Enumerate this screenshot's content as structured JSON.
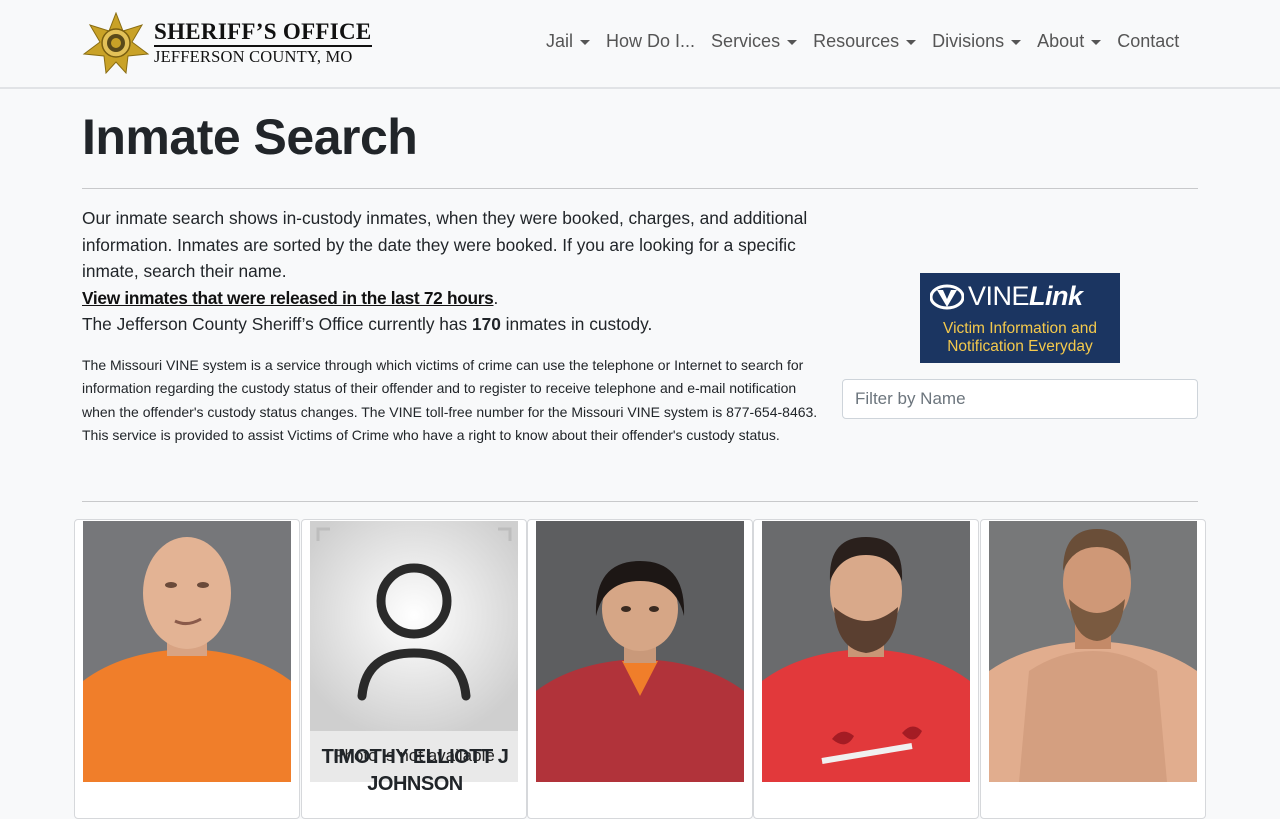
{
  "header": {
    "logo_title": "SHERIFF’S OFFICE",
    "logo_subtitle": "JEFFERSON COUNTY, MO",
    "nav": [
      {
        "label": "Jail",
        "dropdown": true
      },
      {
        "label": "How Do I...",
        "dropdown": false
      },
      {
        "label": "Services",
        "dropdown": true
      },
      {
        "label": "Resources",
        "dropdown": true
      },
      {
        "label": "Divisions",
        "dropdown": true
      },
      {
        "label": "About",
        "dropdown": true
      },
      {
        "label": "Contact",
        "dropdown": false
      }
    ]
  },
  "page": {
    "title": "Inmate Search",
    "intro": "Our inmate search shows in-custody inmates, when they were booked, charges, and additional information. Inmates are sorted by the date they were booked. If you are looking for a specific inmate, search their name.",
    "released_link": "View inmates that were released in the last 72 hours",
    "custody_prefix": "The Jefferson County Sheriff’s Office currently has ",
    "custody_count": "170",
    "custody_suffix": " inmates in custody.",
    "vine_description": "The Missouri VINE system is a service through which victims of crime can use the telephone or Internet to search for information regarding the custody status of their offender and to register to receive telephone and e-mail notification when the offender's custody status changes. The VINE toll-free number for the Missouri VINE system is 877-654-8463. This service is provided to assist Victims of Crime who have a right to know about their offender's custody status."
  },
  "vine_logo": {
    "brand": "VINE",
    "brand_link": "Link",
    "tagline_1": "Victim Information and",
    "tagline_2": "Notification Everyday"
  },
  "filter": {
    "placeholder": "Filter by Name"
  },
  "inmates": [
    {
      "photo": "mugshot"
    },
    {
      "photo": "placeholder",
      "photo_label": "Photo is not available",
      "name": "TIMOTHY ELLIOTT J JOHNSON"
    },
    {
      "photo": "mugshot"
    },
    {
      "photo": "mugshot"
    },
    {
      "photo": "mugshot"
    }
  ],
  "colors": {
    "vine_blue": "#1b3561",
    "vine_gold": "#f4c94c",
    "gold_star": "#c9a227"
  }
}
